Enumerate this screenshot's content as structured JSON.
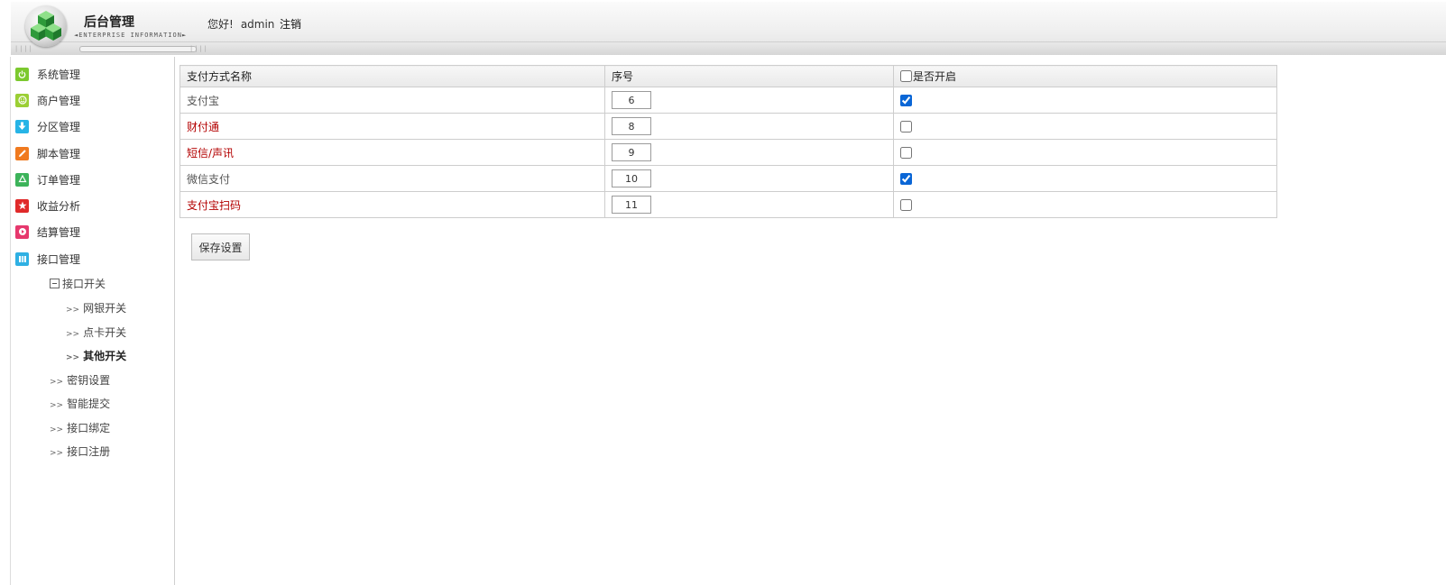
{
  "header": {
    "brand_title": "后台管理",
    "brand_subtitle": "◄ENTERPRISE INFORMATION►",
    "greeting": "您好!",
    "username": "admin",
    "logout_label": "注销"
  },
  "sidebar": {
    "items": [
      {
        "label": "系统管理",
        "icon": "power-icon",
        "color": "#7cc92f"
      },
      {
        "label": "商户管理",
        "icon": "smile-icon",
        "color": "#9bcf34"
      },
      {
        "label": "分区管理",
        "icon": "download-icon",
        "color": "#27b4e6"
      },
      {
        "label": "脚本管理",
        "icon": "pencil-icon",
        "color": "#f07a1f"
      },
      {
        "label": "订单管理",
        "icon": "recycle-icon",
        "color": "#3cb35a"
      },
      {
        "label": "收益分析",
        "icon": "star-icon",
        "color": "#e02a2a"
      },
      {
        "label": "结算管理",
        "icon": "play-icon",
        "color": "#e6386d"
      },
      {
        "label": "接口管理",
        "icon": "grid-icon",
        "color": "#2fb0e3"
      }
    ],
    "subtree": {
      "group_label": "接口开关",
      "children": [
        "网银开关",
        "点卡开关",
        "其他开关"
      ],
      "active_child": "其他开关"
    },
    "sub_items": [
      "密钥设置",
      "智能提交",
      "接口绑定",
      "接口注册"
    ],
    "arrow_glyph": ">>"
  },
  "table": {
    "headers": {
      "name": "支付方式名称",
      "seq": "序号",
      "enabled": "是否开启"
    },
    "rows": [
      {
        "name": "支付宝",
        "seq": "6",
        "enabled": true,
        "highlight": false
      },
      {
        "name": "财付通",
        "seq": "8",
        "enabled": false,
        "highlight": true
      },
      {
        "name": "短信/声讯",
        "seq": "9",
        "enabled": false,
        "highlight": true
      },
      {
        "name": "微信支付",
        "seq": "10",
        "enabled": true,
        "highlight": false
      },
      {
        "name": "支付宝扫码",
        "seq": "11",
        "enabled": false,
        "highlight": true
      }
    ]
  },
  "actions": {
    "save_label": "保存设置"
  },
  "colors": {
    "highlight_text": "#b30000",
    "checkbox_accent": "#0a66d6"
  }
}
